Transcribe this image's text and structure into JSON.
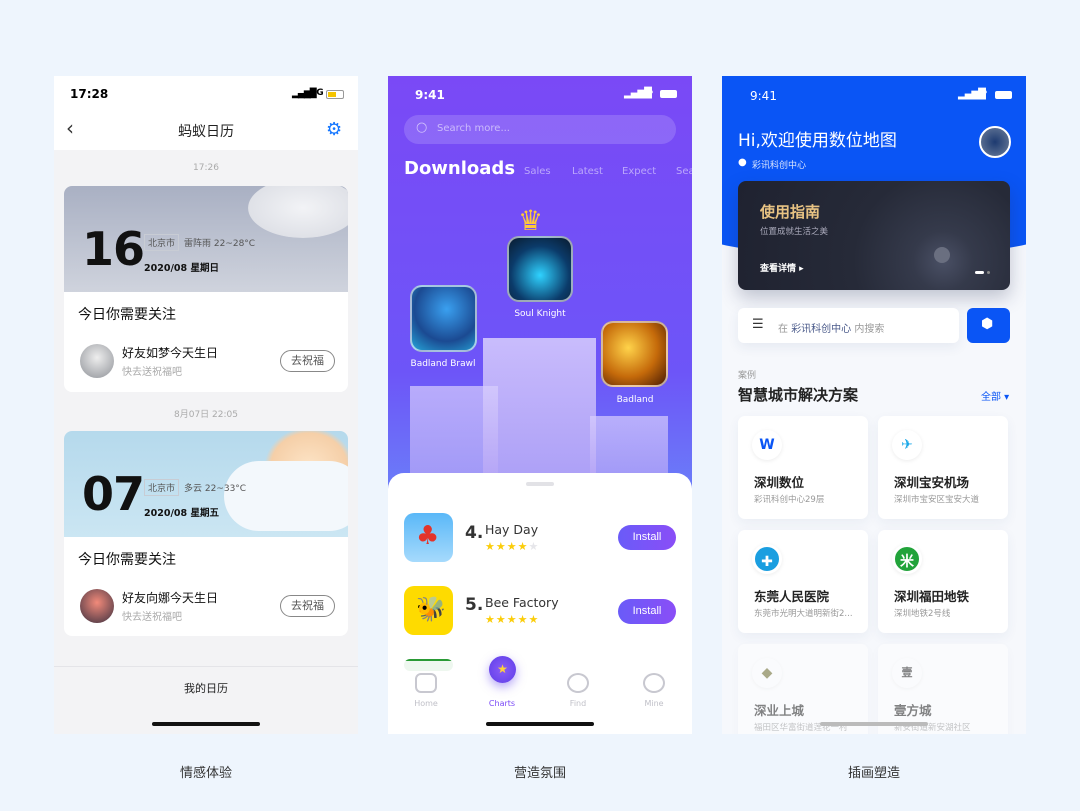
{
  "captions": [
    "情感体验",
    "营造氛围",
    "插画塑造"
  ],
  "calendar": {
    "status_time": "17:28",
    "network": "4G",
    "title": "蚂蚁日历",
    "entries": [
      {
        "timestamp": "17:26",
        "day": "16",
        "city": "北京市",
        "weather": "雷阵雨 22~28°C",
        "date": "2020/08 星期日",
        "section": "今日你需要关注",
        "friend": "好友如梦今天生日",
        "hint": "快去送祝福吧",
        "button": "去祝福"
      },
      {
        "timestamp": "8月07日 22:05",
        "day": "07",
        "city": "北京市",
        "weather": "多云 22~33°C",
        "date": "2020/08 星期五",
        "section": "今日你需要关注",
        "friend": "好友向娜今天生日",
        "hint": "快去送祝福吧",
        "button": "去祝福"
      }
    ],
    "bottom_label": "我的日历"
  },
  "games": {
    "status_time": "9:41",
    "search_placeholder": "Search more...",
    "tabs": [
      "Downloads",
      "Sales",
      "Latest",
      "Expect",
      "Sea"
    ],
    "podium": [
      {
        "rank": 1,
        "name": "Soul Knight"
      },
      {
        "rank": 2,
        "name": "Badland Brawl"
      },
      {
        "rank": 3,
        "name": "Badland"
      }
    ],
    "list": [
      {
        "rank": "4.",
        "name": "Hay Day",
        "stars": "★★★★",
        "empty_stars": "★",
        "rating": 4,
        "button": "Install"
      },
      {
        "rank": "5.",
        "name": "Bee Factory",
        "stars": "★★★★★",
        "empty_stars": "",
        "rating": 5,
        "button": "Install"
      }
    ],
    "nav": [
      "Home",
      "Charts",
      "Find",
      "Mine"
    ],
    "active_nav": "Charts",
    "accent": "#7a49f6"
  },
  "map": {
    "status_time": "9:41",
    "greeting": "Hi,欢迎使用数位地图",
    "location": "彩讯科创中心",
    "banner": {
      "title": "使用指南",
      "subtitle": "位置成就生活之美",
      "link": "查看详情 ▸"
    },
    "search": {
      "prefix": "在",
      "place": "彩讯科创中心",
      "suffix": "内搜索"
    },
    "section_label": "案例",
    "section_title": "智慧城市解决方案",
    "filter": "全部 ▾",
    "cases": [
      {
        "title": "深圳数位",
        "sub": "彩讯科创中心29层"
      },
      {
        "title": "深圳宝安机场",
        "sub": "深圳市宝安区宝安大道"
      },
      {
        "title": "东莞人民医院",
        "sub": "东莞市光明大道明新街2..."
      },
      {
        "title": "深圳福田地铁",
        "sub": "深圳地铁2号线"
      },
      {
        "title": "深业上城",
        "sub": "福田区华富街道莲花一村"
      },
      {
        "title": "壹方城",
        "sub": "新安街道新安湖社区"
      }
    ],
    "accent": "#0a55f5"
  }
}
